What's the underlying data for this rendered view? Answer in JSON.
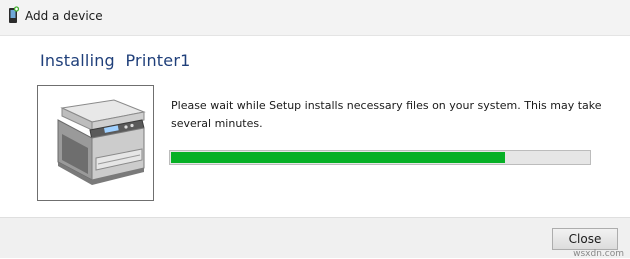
{
  "window": {
    "title": "Add a device",
    "icon": "add-device-icon"
  },
  "main": {
    "heading": "Installing  Printer1",
    "message": "Please wait while Setup installs necessary files on your system. This may take several minutes.",
    "device_image": "printer-image",
    "progress": {
      "value": 0.8,
      "color": "#06b025"
    }
  },
  "footer": {
    "close_label": "Close"
  },
  "watermark": "wsxdn.com"
}
